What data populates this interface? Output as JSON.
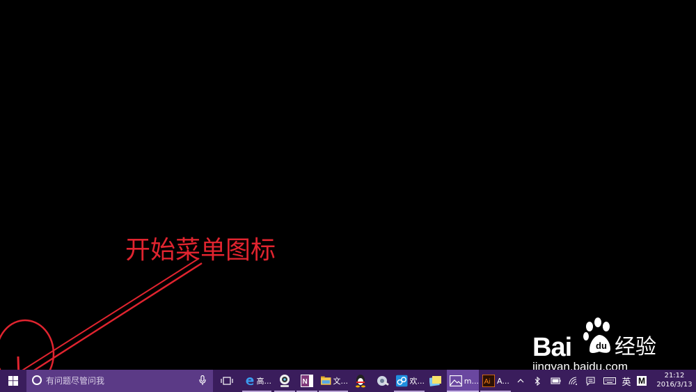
{
  "annotation": {
    "label": "开始菜单图标",
    "color": "#e0242f"
  },
  "watermark": {
    "brand_left": "Bai",
    "brand_right": "",
    "brand_cn": "经验",
    "url": "jingyan.baidu.com"
  },
  "taskbar": {
    "background": "#3a1d5c",
    "start_icon": "windows-logo-icon",
    "search": {
      "placeholder": "有问题尽管问我",
      "icon": "cortana-circle-icon",
      "mic_icon": "microphone-icon"
    },
    "task_view_icon": "task-view-icon",
    "apps": [
      {
        "icon": "edge-icon",
        "label": "高..."
      },
      {
        "icon": "webcam-icon",
        "label": ""
      },
      {
        "icon": "onenote-icon",
        "label": ""
      },
      {
        "icon": "file-explorer-icon",
        "label": "文..."
      },
      {
        "icon": "qq-penguin-icon",
        "label": ""
      },
      {
        "icon": "tool-icon",
        "label": ""
      },
      {
        "icon": "browser-icon",
        "label": "欢..."
      },
      {
        "icon": "sticky-notes-icon",
        "label": ""
      },
      {
        "icon": "photos-icon",
        "label": "m..."
      },
      {
        "icon": "illustrator-icon",
        "label": "A..."
      }
    ],
    "tray": {
      "overflow_icon": "chevron-up-icon",
      "bluetooth_icon": "bluetooth-icon",
      "battery_icon": "battery-icon",
      "wifi_icon": "wifi-icon",
      "notification_icon": "action-center-icon",
      "keyboard_icon": "keyboard-icon",
      "ime_label": "英",
      "ime_mode": "M",
      "time": "21:12",
      "date": "2016/3/13"
    }
  }
}
